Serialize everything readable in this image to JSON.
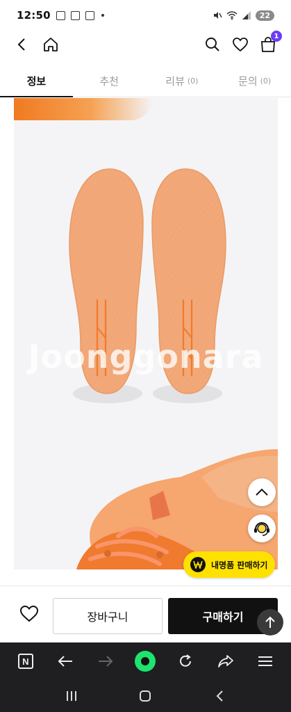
{
  "status": {
    "time": "12:50",
    "battery": "22"
  },
  "tabs": [
    {
      "label": "정보",
      "count": ""
    },
    {
      "label": "추천",
      "count": ""
    },
    {
      "label": "리뷰",
      "count": "(0)"
    },
    {
      "label": "문의",
      "count": "(0)"
    }
  ],
  "header": {
    "cart_count": "1"
  },
  "content": {
    "watermark": "Joonggonara"
  },
  "floating": {
    "sell_label": "내명품 판매하기"
  },
  "actions": {
    "cart_label": "장바구니",
    "buy_label": "구매하기"
  },
  "colors": {
    "accent": "#6b3cf5",
    "buy": "#111111",
    "sell": "#ffe100",
    "insole": "#f2a878"
  }
}
